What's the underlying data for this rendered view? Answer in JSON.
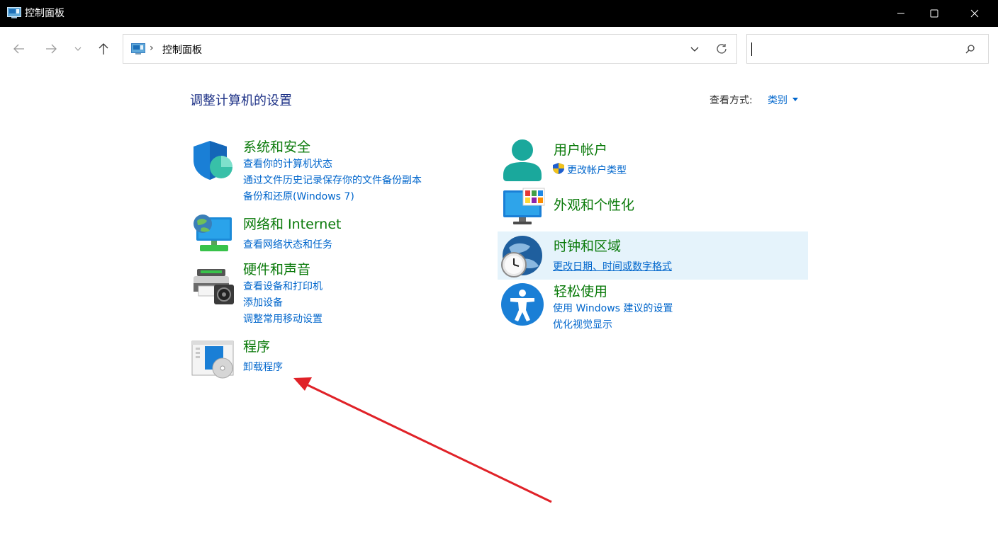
{
  "window": {
    "title": "控制面板"
  },
  "address": {
    "text": "控制面板",
    "separator": "›"
  },
  "search": {
    "value": ""
  },
  "page": {
    "heading": "调整计算机的设置",
    "view_by_label": "查看方式:",
    "view_by_value": "类别"
  },
  "categories": [
    {
      "title": "系统和安全",
      "links": [
        "查看你的计算机状态",
        "通过文件历史记录保存你的文件备份副本",
        "备份和还原(Windows 7)"
      ]
    },
    {
      "title": "网络和 Internet",
      "links": [
        "查看网络状态和任务"
      ]
    },
    {
      "title": "硬件和声音",
      "links": [
        "查看设备和打印机",
        "添加设备",
        "调整常用移动设置"
      ]
    },
    {
      "title": "程序",
      "links": [
        "卸载程序"
      ]
    },
    {
      "title": "用户帐户",
      "links": [
        "更改帐户类型"
      ]
    },
    {
      "title": "外观和个性化",
      "links": []
    },
    {
      "title": "时钟和区域",
      "links": [
        "更改日期、时间或数字格式"
      ]
    },
    {
      "title": "轻松使用",
      "links": [
        "使用 Windows 建议的设置",
        "优化视觉显示"
      ]
    }
  ],
  "colors": {
    "category_title": "#0a7a0a",
    "link": "#0066cc",
    "heading": "#1e3287",
    "highlight": "#e5f3fb",
    "annotation_arrow": "#e02228"
  },
  "icons": {
    "minimize": "minimize-icon",
    "maximize": "maximize-icon",
    "close": "close-icon",
    "back": "back-arrow-icon",
    "forward": "forward-arrow-icon",
    "recent": "chevron-down-icon",
    "up": "up-arrow-icon",
    "refresh": "refresh-icon",
    "search": "search-icon",
    "shield": "uac-shield-icon"
  }
}
